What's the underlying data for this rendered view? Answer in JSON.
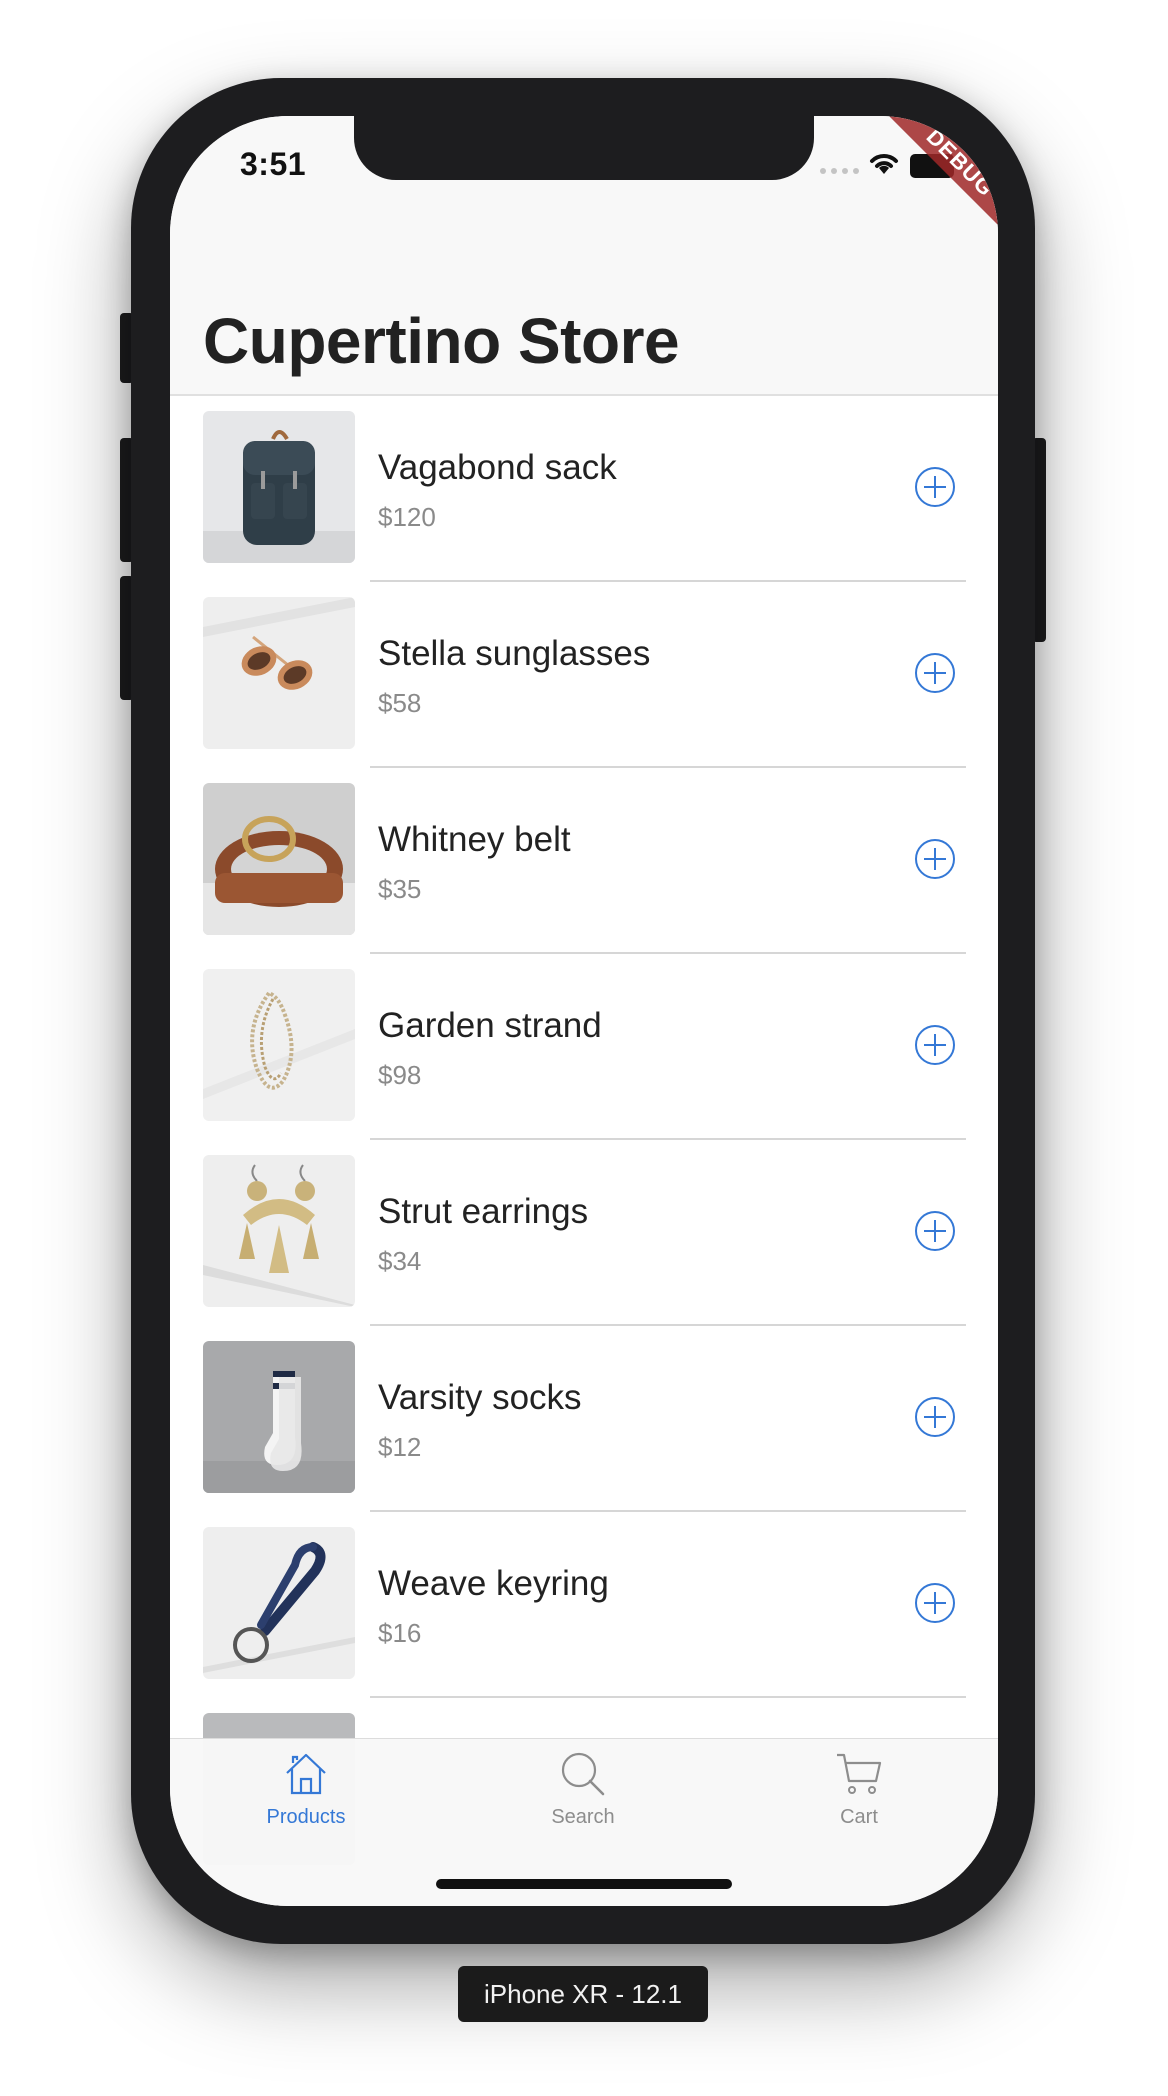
{
  "status_bar": {
    "time": "3:51",
    "debug_ribbon": "DEBUG"
  },
  "nav": {
    "title": "Cupertino Store"
  },
  "products": [
    {
      "name": "Vagabond sack",
      "price": "$120"
    },
    {
      "name": "Stella sunglasses",
      "price": "$58"
    },
    {
      "name": "Whitney belt",
      "price": "$35"
    },
    {
      "name": "Garden strand",
      "price": "$98"
    },
    {
      "name": "Strut earrings",
      "price": "$34"
    },
    {
      "name": "Varsity socks",
      "price": "$12"
    },
    {
      "name": "Weave keyring",
      "price": "$16"
    }
  ],
  "tabs": [
    {
      "label": "Products",
      "icon": "home-icon",
      "active": true
    },
    {
      "label": "Search",
      "icon": "search-icon",
      "active": false
    },
    {
      "label": "Cart",
      "icon": "cart-icon",
      "active": false
    }
  ],
  "device_label": "iPhone XR - 12.1",
  "colors": {
    "accent": "#3478d6",
    "inactive": "#8d8d8d",
    "title": "#222222",
    "price": "#8a8a8a"
  }
}
